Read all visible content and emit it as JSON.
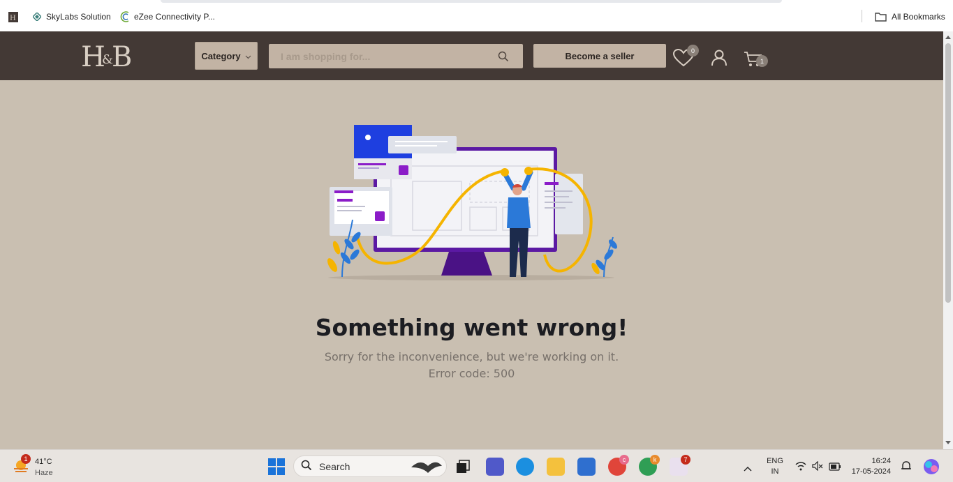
{
  "bookmarks": {
    "items": [
      {
        "label": "SkyLabs Solution",
        "icon": "skylabs-icon"
      },
      {
        "label": "eZee Connectivity P...",
        "icon": "ezee-icon"
      }
    ],
    "all_bookmarks": "All Bookmarks"
  },
  "header": {
    "logo": "H&B",
    "category_label": "Category",
    "search_placeholder": "I am shopping for...",
    "seller_label": "Become a seller",
    "wishlist_count": "0",
    "cart_count": "1",
    "colors": {
      "header_bg": "#433935",
      "button_bg": "#c2b3a4",
      "page_bg": "#c9bfb1"
    }
  },
  "error": {
    "title": "Something went wrong!",
    "message": "Sorry for the inconvenience, but we're working on it.",
    "code": "Error code: 500"
  },
  "taskbar": {
    "weather_badge": "1",
    "temperature": "41°C",
    "condition": "Haze",
    "search_label": "Search",
    "chrome1_badge": "c",
    "chrome2_badge": "k",
    "slack_badge": "7",
    "lang_line1": "ENG",
    "lang_line2": "IN",
    "time": "16:24",
    "date": "17-05-2024"
  }
}
